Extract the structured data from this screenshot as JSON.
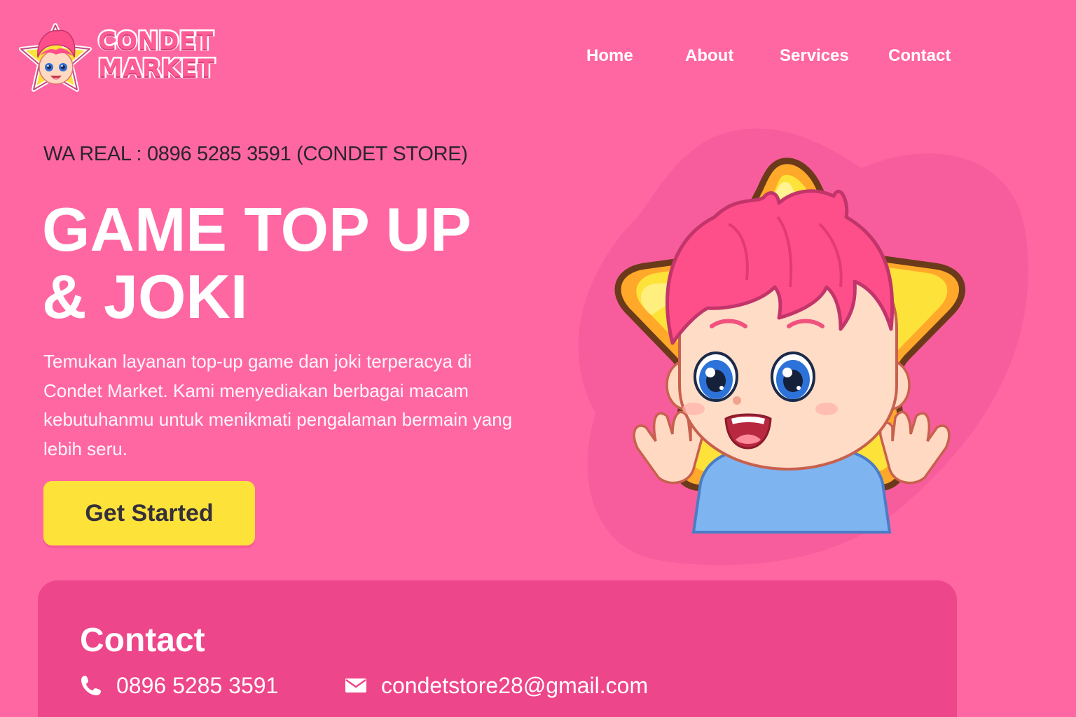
{
  "brand": {
    "name_line1": "CONDET",
    "name_line2": "MARKET"
  },
  "nav": {
    "items": [
      {
        "label": "Home"
      },
      {
        "label": "About"
      },
      {
        "label": "Services"
      },
      {
        "label": "Contact"
      }
    ]
  },
  "hero": {
    "wa_prefix": "WA REAL : ",
    "wa_number": "0896 5285 3591",
    "wa_suffix": " (CONDET STORE)",
    "title_line1": "GAME TOP UP",
    "title_line2": "& JOKI",
    "description": "Temukan layanan top-up game dan joki terperacya di Condet Market. Kami menyediakan berbagai macam kebutuhanmu untuk menikmati pengalaman bermain yang lebih seru.",
    "cta_label": "Get Started"
  },
  "contact": {
    "title": "Contact",
    "phone": "0896 5285 3591",
    "email": "condetstore28@gmail.com"
  },
  "icons": {
    "phone": "phone-icon",
    "email": "envelope-icon"
  },
  "colors": {
    "background": "#ff67a2",
    "accent_yellow": "#fde23a",
    "card_pink": "#ee468a",
    "text_white": "#ffffff",
    "text_dark": "#2b2430"
  }
}
